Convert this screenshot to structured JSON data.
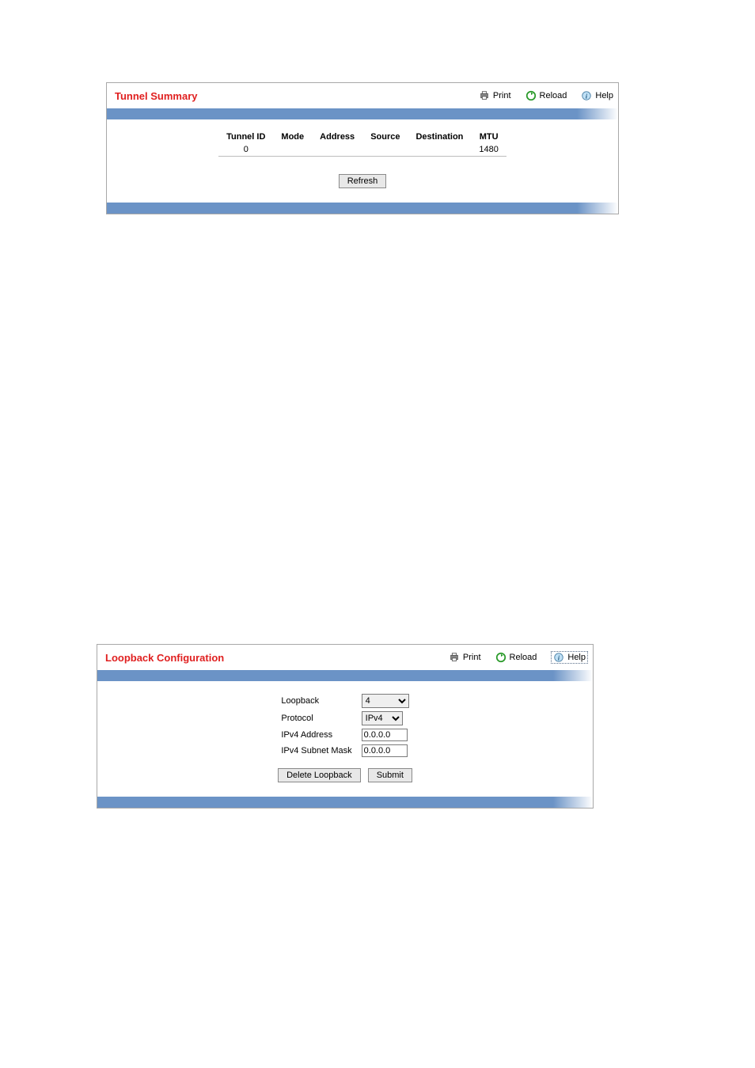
{
  "toolbar": {
    "print": "Print",
    "reload": "Reload",
    "help": "Help"
  },
  "panel1": {
    "title": "Tunnel Summary",
    "columns": {
      "tunnel_id": "Tunnel ID",
      "mode": "Mode",
      "address": "Address",
      "source": "Source",
      "destination": "Destination",
      "mtu": "MTU"
    },
    "row": {
      "tunnel_id": "0",
      "mode": "",
      "address": "",
      "source": "",
      "destination": "",
      "mtu": "1480"
    },
    "refresh": "Refresh"
  },
  "panel2": {
    "title": "Loopback Configuration",
    "labels": {
      "loopback": "Loopback",
      "protocol": "Protocol",
      "ipv4_address": "IPv4 Address",
      "ipv4_subnet_mask": "IPv4 Subnet Mask"
    },
    "values": {
      "loopback": "4",
      "protocol": "IPv4",
      "ipv4_address": "0.0.0.0",
      "ipv4_subnet_mask": "0.0.0.0"
    },
    "buttons": {
      "delete": "Delete Loopback",
      "submit": "Submit"
    }
  }
}
